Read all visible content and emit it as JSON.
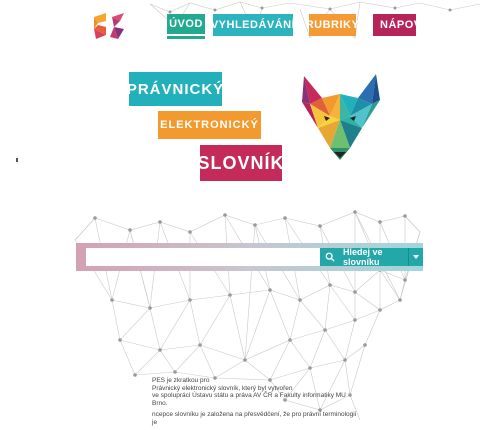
{
  "nav": {
    "items": [
      {
        "label": "Úvod",
        "color": "#22a98f",
        "active": true
      },
      {
        "label": "Vyhledávání",
        "color": "#2bb3be",
        "active": false
      },
      {
        "label": "Rubriky",
        "color": "#f39a35",
        "active": false
      },
      {
        "label": "Nápově",
        "color": "#b6255a",
        "active": false
      }
    ]
  },
  "brand": {
    "logo_colors": [
      "#f7a430",
      "#e04a6d",
      "#8a2f7a"
    ],
    "title_lines": [
      "Právnický",
      "Elektronický",
      "Slovník"
    ],
    "title_colors": [
      "#22b0ba",
      "#f39a2f",
      "#c42a5a"
    ]
  },
  "search": {
    "value": "",
    "placeholder": "",
    "button_label": "Hledej ve slovníku",
    "button_icon": "search-icon",
    "dropdown_icon": "caret-down-icon",
    "button_color": "#24a7a9"
  },
  "intro": {
    "lines_1": [
      "PES je zkratkou pro",
      "Právnický elektronický slovník, který byl vytvořen",
      "ve spolupráci Ústavu státu a práva AV ČR a Fakulty informatiky MU Brno."
    ],
    "line_2": "ncepce slovníku je založena na přesvědčení, že pro právní terminologii je"
  }
}
